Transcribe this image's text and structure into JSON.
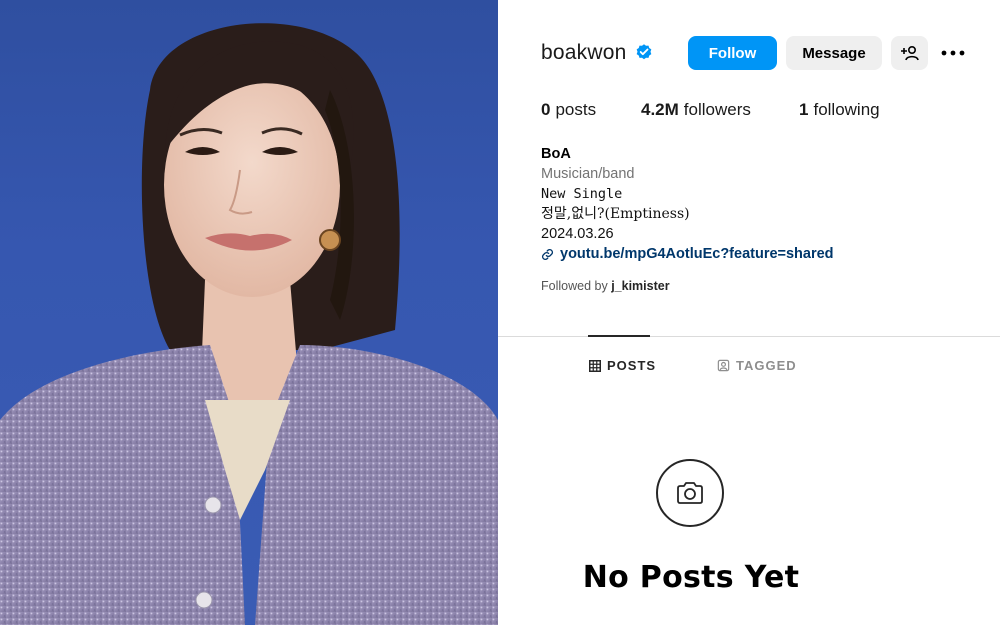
{
  "photo": {
    "alt": ""
  },
  "profile": {
    "username": "boakwon",
    "verified": true,
    "buttons": {
      "follow": "Follow",
      "message": "Message"
    },
    "stats": {
      "posts_count": "0",
      "posts_label": "posts",
      "followers_count": "4.2M",
      "followers_label": "followers",
      "following_count": "1",
      "following_label": "following"
    },
    "bio": {
      "name": "BoA",
      "category": "Musician/band",
      "line1": "New Single",
      "line2": "정말,없니?(Emptiness)",
      "line3": "2024.03.26",
      "link": "youtu.be/mpG4AotluEc?feature=shared"
    },
    "followed_by": {
      "prefix": "Followed by",
      "user": "j_kimister"
    },
    "tabs": {
      "posts": "POSTS",
      "tagged": "TAGGED"
    },
    "empty_state": {
      "title": "No Posts Yet"
    }
  },
  "colors": {
    "follow_blue": "#0095f6",
    "verified_blue": "#0095f6",
    "link_blue": "#00376b",
    "photo_background": "#3657b0"
  },
  "icons": [
    "verified-badge-icon",
    "add-user-icon",
    "more-options-icon",
    "link-icon",
    "grid-icon",
    "tagged-icon",
    "camera-icon"
  ]
}
